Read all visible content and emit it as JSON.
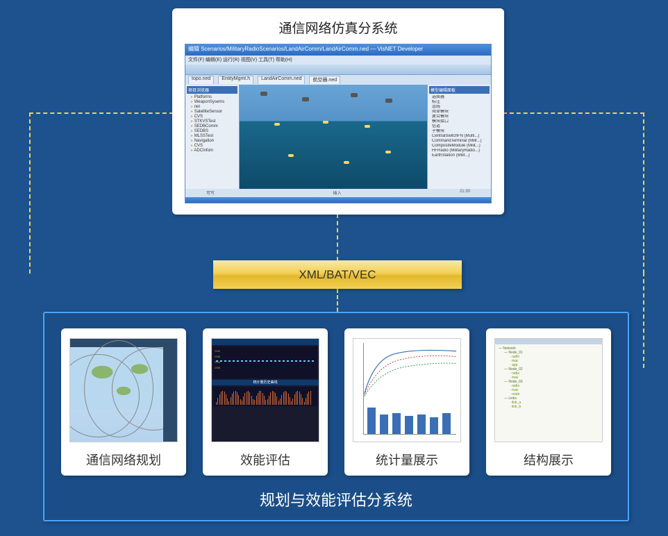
{
  "top": {
    "title": "通信网络仿真分系统",
    "screenshot": {
      "titlebar": "编辑  Scenarios/MilitaryRadioScenarios/LandAirComm/LandAirComm.ned — VisNET Developer",
      "menubar": "文件(F) 编辑(E) 运行(R) 视图(V) 工具(T) 帮助(H)",
      "tabs": [
        "topo.ned",
        "EntityMgmt.h",
        "LandAirComm.ned",
        "航空器.ned"
      ],
      "tree_header": "项目浏览器",
      "tree": [
        "Platforms",
        "WeaponSysems",
        "net",
        "SatelliteSensor",
        "CVS",
        "STKVSTest",
        "SEDBComm",
        "SEDBS",
        "MLSSTest",
        "Navigation",
        "CVS",
        "ADCInfoIn"
      ],
      "right_header": "模型编辑面板",
      "right_items": [
        "选择器",
        "标注",
        "连线",
        "简单模块",
        "复合模块",
        "模块接口",
        "信道",
        "子模块",
        "CentralSwitchFN (Multi...)",
        "CommandTerminal (Milit...)",
        "CompositeModule (Milit...)",
        "HFRadio (MilitaryRadio...)",
        "EarthStation (Milit...)"
      ],
      "status": {
        "left": "可写",
        "center": "插入",
        "right": "21:30"
      }
    }
  },
  "gold_label": "XML/BAT/VEC",
  "lower": {
    "title": "规划与效能评估分系统",
    "cards": [
      {
        "label": "通信网络规划"
      },
      {
        "label": "效能评估"
      },
      {
        "label": "统计量展示"
      },
      {
        "label": "结构展示"
      }
    ]
  },
  "perf": {
    "hist_title": "统计量历史曲线"
  }
}
